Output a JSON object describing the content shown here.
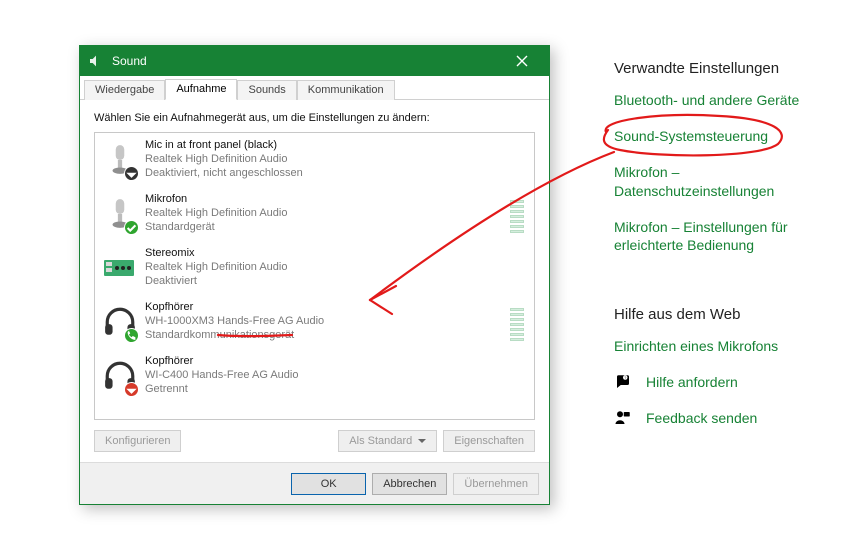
{
  "dialog": {
    "title": "Sound",
    "tabs": [
      "Wiedergabe",
      "Aufnahme",
      "Sounds",
      "Kommunikation"
    ],
    "active_tab_index": 1,
    "instruction": "Wählen Sie ein Aufnahmegerät aus, um die Einstellungen zu ändern:",
    "devices": [
      {
        "name": "Mic in at front panel (black)",
        "driver": "Realtek High Definition Audio",
        "status": "Deaktiviert, nicht angeschlossen",
        "icon": "mic",
        "badge": "down"
      },
      {
        "name": "Mikrofon",
        "driver": "Realtek High Definition Audio",
        "status": "Standardgerät",
        "icon": "mic",
        "badge": "check",
        "meter": true
      },
      {
        "name": "Stereomix",
        "driver": "Realtek High Definition Audio",
        "status": "Deaktiviert",
        "icon": "card",
        "badge": "none"
      },
      {
        "name": "Kopfhörer",
        "driver": "WH-1000XM3 Hands-Free AG Audio",
        "status": "Standardkommunikationsgerät",
        "icon": "headphones",
        "badge": "phone",
        "meter": true
      },
      {
        "name": "Kopfhörer",
        "driver": "WI-C400 Hands-Free AG Audio",
        "status": "Getrennt",
        "icon": "headphones",
        "badge": "down-red"
      }
    ],
    "buttons": {
      "configure": "Konfigurieren",
      "set_default": "Als Standard",
      "properties": "Eigenschaften",
      "ok": "OK",
      "cancel": "Abbrechen",
      "apply": "Übernehmen"
    }
  },
  "right": {
    "heading1": "Verwandte Einstellungen",
    "links": [
      "Bluetooth- und andere Geräte",
      "Sound-Systemsteuerung",
      "Mikrofon – Datenschutzeinstellungen",
      "Mikrofon – Einstellungen für erleichterte Bedienung"
    ],
    "heading2": "Hilfe aus dem Web",
    "help_link": "Einrichten eines Mikrofons",
    "get_help": "Hilfe anfordern",
    "feedback": "Feedback senden"
  },
  "colors": {
    "accent": "#178235"
  }
}
